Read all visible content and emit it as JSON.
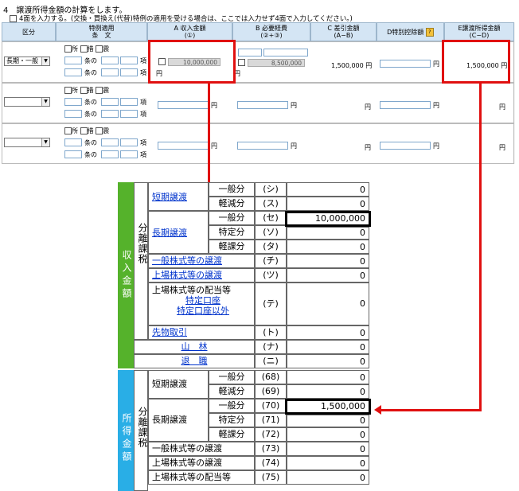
{
  "section": {
    "title": "4　譲渡所得金額の計算をします。",
    "note": "4面を入力する。(交換・買換え(代替)特例の適用を受ける場合は、ここでは入力せず4面で入力してください。)"
  },
  "headers": {
    "kubun": "区分",
    "tokurei": "特例適用\n条　文",
    "a": "A 収入金額\n(①)",
    "b": "B 必要経費\n(②+③)",
    "c": "C 差引金額\n(A−B)",
    "d": "D特別控除額",
    "e": "E譲渡所得金額\n(C−D)"
  },
  "form_labels": {
    "sho": "所",
    "soh": "措",
    "shin": "震",
    "jou_no": "条の",
    "kou": "項",
    "yen": "円"
  },
  "rows": [
    {
      "kubun": "長期・一般",
      "a": "10,000,000",
      "b": "8,500,000",
      "c": "1,500,000 円",
      "e": "1,500,000 円"
    },
    {
      "kubun": "",
      "a": "",
      "b": "",
      "c": "円",
      "e": "円"
    },
    {
      "kubun": "",
      "a": "",
      "b": "",
      "c": "円",
      "e": "円"
    }
  ],
  "lower": {
    "group_income": "収入金額",
    "group_shotoku": "所得金額",
    "bunri": "分離課税",
    "tanki": "短期譲渡",
    "chouki": "長期譲渡",
    "ippan": "一般分",
    "keigen": "軽減分",
    "tokutei": "特定分",
    "keika": "軽課分",
    "ippan_kabu": "一般株式等の譲渡",
    "jojo_kabu": "上場株式等の譲渡",
    "haitou": "上場株式等の配当等",
    "tokutei_kouza": "特定口座",
    "tokutei_igai": "特定口座以外",
    "sakimono": "先物取引",
    "sanrin": "山　林",
    "taishoku": "退　職",
    "codes_income": [
      "(シ)",
      "(ス)",
      "(セ)",
      "(ソ)",
      "(タ)",
      "(チ)",
      "(ツ)",
      "(テ)",
      "(ト)",
      "(ナ)",
      "(ニ)"
    ],
    "codes_shotoku": [
      "(68)",
      "(69)",
      "(70)",
      "(71)",
      "(72)",
      "(73)",
      "(74)",
      "(75)"
    ],
    "values_income": [
      "0",
      "0",
      "10,000,000",
      "0",
      "0",
      "0",
      "0",
      "0",
      "0",
      "0",
      "0"
    ],
    "values_shotoku": [
      "0",
      "0",
      "1,500,000",
      "0",
      "0",
      "0",
      "0",
      "0"
    ]
  }
}
